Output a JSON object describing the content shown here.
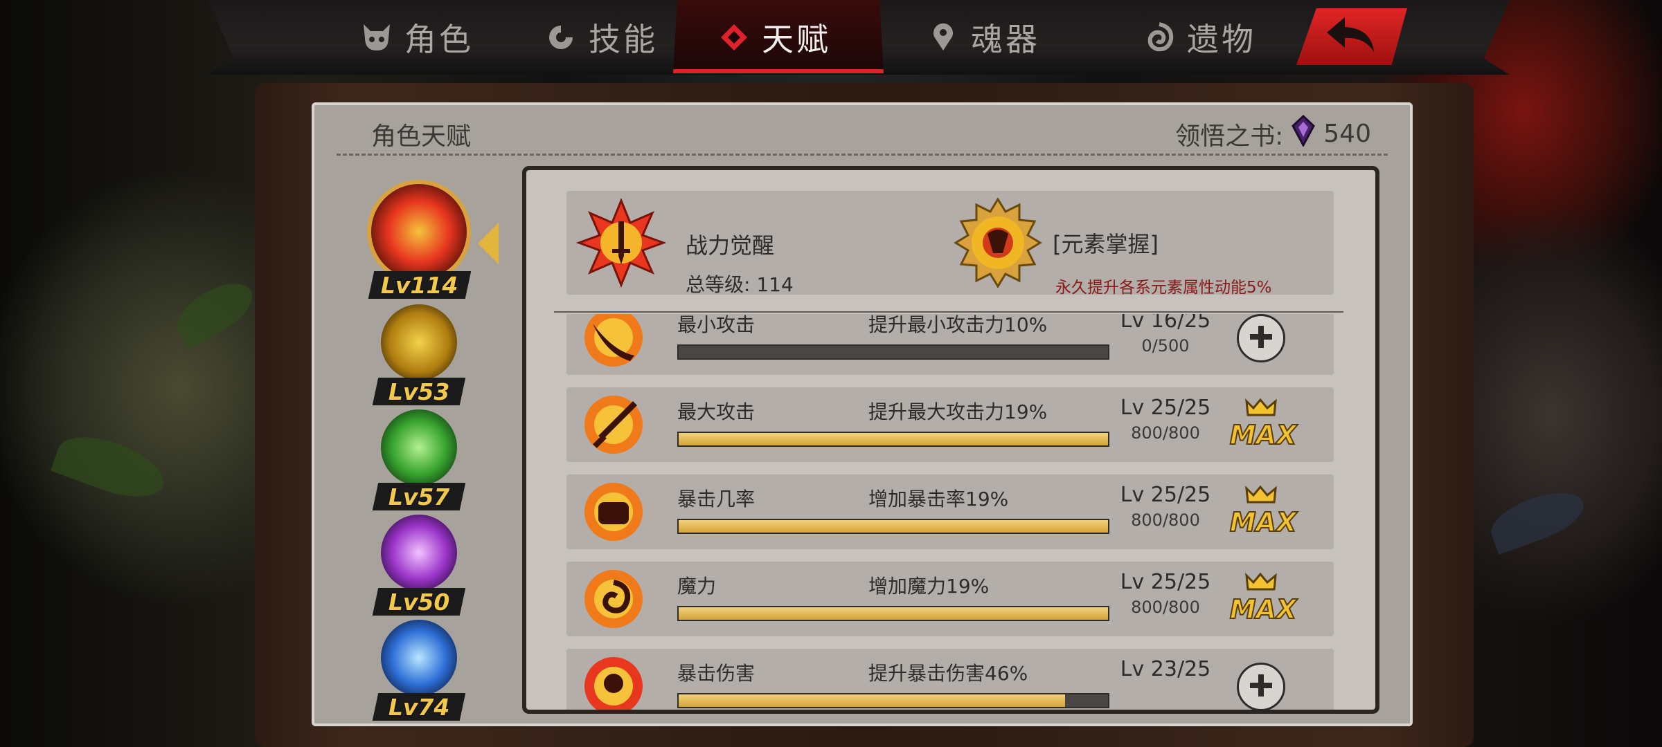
{
  "tabs": [
    {
      "label": "角色",
      "icon": "demon-mask-icon"
    },
    {
      "label": "技能",
      "icon": "swirl-icon"
    },
    {
      "label": "天赋",
      "icon": "diamond-emblem-icon",
      "active": true
    },
    {
      "label": "魂器",
      "icon": "soul-pin-icon"
    },
    {
      "label": "遗物",
      "icon": "spiral-icon"
    }
  ],
  "panel": {
    "title": "角色天赋",
    "book_label": "领悟之书:",
    "book_count": "540"
  },
  "characters": [
    {
      "level": "Lv114",
      "icon": "flame-sword-icon",
      "color": "#e03020"
    },
    {
      "level": "Lv53",
      "icon": "shield-cross-icon",
      "color": "#d1a21c"
    },
    {
      "level": "Lv57",
      "icon": "green-heal-icon",
      "color": "#3aa038"
    },
    {
      "level": "Lv50",
      "icon": "purple-star-icon",
      "color": "#9b35c9"
    },
    {
      "level": "Lv74",
      "icon": "blue-hexagram-icon",
      "color": "#2e6fd6"
    }
  ],
  "summary": {
    "title": "战力觉醒",
    "total_level": "总等级: 114",
    "skill_title": "[元素掌握]",
    "skill_desc": "永久提升各系元素属性动能5%"
  },
  "talents": [
    {
      "name": "最小攻击",
      "desc": "提升最小攻击力10%",
      "level": "Lv 16/25",
      "progress_text": "0/500",
      "progress": 0.0,
      "maxed": false,
      "icon": "blade-icon"
    },
    {
      "name": "最大攻击",
      "desc": "提升最大攻击力19%",
      "level": "Lv 25/25",
      "progress_text": "800/800",
      "progress": 1.0,
      "maxed": true,
      "icon": "sword-flame-icon"
    },
    {
      "name": "暴击几率",
      "desc": "增加暴击率19%",
      "level": "Lv 25/25",
      "progress_text": "800/800",
      "progress": 1.0,
      "maxed": true,
      "icon": "fist-flame-icon"
    },
    {
      "name": "魔力",
      "desc": "增加魔力19%",
      "level": "Lv 25/25",
      "progress_text": "800/800",
      "progress": 1.0,
      "maxed": true,
      "icon": "magic-swirl-icon"
    },
    {
      "name": "暴击伤害",
      "desc": "提升暴击伤害46%",
      "level": "Lv 23/25",
      "progress_text": "",
      "progress": 0.9,
      "maxed": false,
      "icon": "skull-flame-icon"
    }
  ],
  "max_label": "MAX"
}
